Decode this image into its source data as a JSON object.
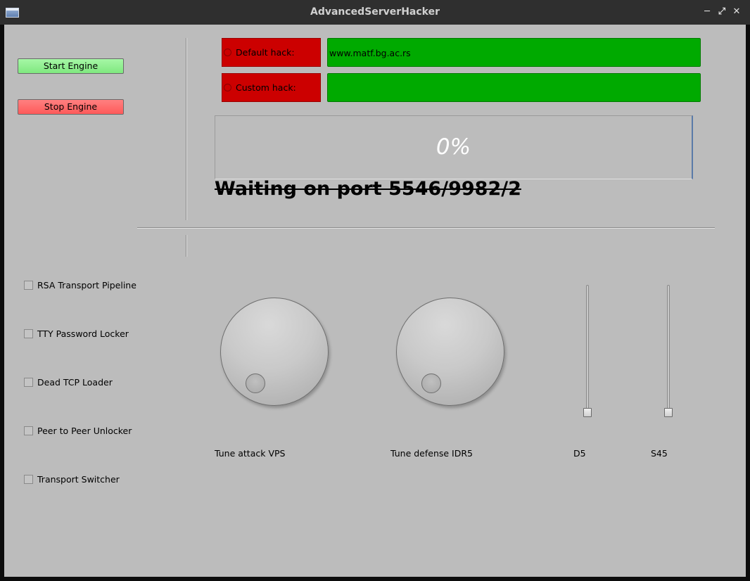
{
  "window": {
    "title": "AdvancedServerHacker",
    "controls": [
      "minimize-icon",
      "maximize-icon",
      "close-icon"
    ]
  },
  "engine": {
    "start_label": "Start Engine",
    "stop_label": "Stop Engine"
  },
  "hacks": [
    {
      "label": "Default hack:",
      "value": "www.matf.bg.ac.rs"
    },
    {
      "label": "Custom hack:",
      "value": ""
    }
  ],
  "progress": {
    "value_percent": 0,
    "text": "0%"
  },
  "status": {
    "text": "Waiting on port  5546/9982/2"
  },
  "options": [
    {
      "label": "RSA Transport Pipeline",
      "checked": false
    },
    {
      "label": "TTY Password Locker",
      "checked": false
    },
    {
      "label": "Dead TCP Loader",
      "checked": false
    },
    {
      "label": "Peer to Peer Unlocker",
      "checked": false
    },
    {
      "label": "Transport Switcher",
      "checked": false
    }
  ],
  "dials": [
    {
      "label": "Tune attack VPS"
    },
    {
      "label": "Tune defense IDR5"
    }
  ],
  "sliders": [
    {
      "label": "D5"
    },
    {
      "label": "S45"
    }
  ],
  "colors": {
    "hack_label_bg": "#cc0000",
    "hack_field_bg": "#00aa00",
    "start_button_bg": "#8ff08f",
    "stop_button_bg": "#ff6a6a",
    "client_bg": "#bcbcbc"
  }
}
